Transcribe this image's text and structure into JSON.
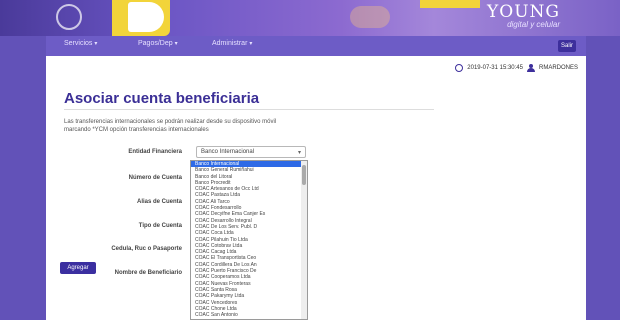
{
  "header": {
    "brand": "YOUNG",
    "tagline": "digital y celular"
  },
  "nav": {
    "items": [
      {
        "label": "Servicios"
      },
      {
        "label": "Pagos/Dep"
      },
      {
        "label": "Administrar"
      }
    ],
    "exit_label": "Salir"
  },
  "meta": {
    "datetime": "2019-07-31 15:30:45",
    "username": "RMARDONES"
  },
  "page": {
    "title": "Asociar cuenta beneficiaria",
    "notice": "Las transferencias internacionales se podrán realizar desde su dispositivo móvil marcando *YCM opción transferencias internacionales"
  },
  "form": {
    "labels": {
      "bank": "Entidad Financiera",
      "account_number": "Número de Cuenta",
      "alias": "Alias de Cuenta",
      "account_type": "Tipo de Cuenta",
      "id": "Cedula, Ruc o Pasaporte",
      "beneficiary": "Nombre de Beneficiario"
    },
    "bank_select": {
      "selected": "Banco Internacional"
    },
    "bank_options": [
      "Banco Internacional",
      "Banco General Rumiñahui",
      "Banco del Litoral",
      "Banco Procredit",
      "COAC Artesanos de Occ Ltd",
      "COAC Pastaza Ltda",
      "COAC Ali Tarco",
      "COAC Fondesarrollo",
      "COAC Decyifne Ema Canjer Es",
      "COAC Desarrollo Integral",
      "COAC De Los Serv. Publ. D",
      "COAC Coca Ltda",
      "COAC Pilahuin Tio Ltda",
      "COAC Cotobrav Ltda",
      "COAC Cacag Ltda",
      "COAC El Transportista Ceo",
      "COAC Cordillera De Los An",
      "COAC Puerto Francisco De",
      "COAC Cooperamos Ltda",
      "COAC Nuevas Fronteras",
      "COAC Santa Rosa",
      "COAC Pakarymy Ltda",
      "COAC Vencedores",
      "COAC Chone Ltda",
      "COAC San Antonio"
    ],
    "submit_label": "Agregar"
  }
}
